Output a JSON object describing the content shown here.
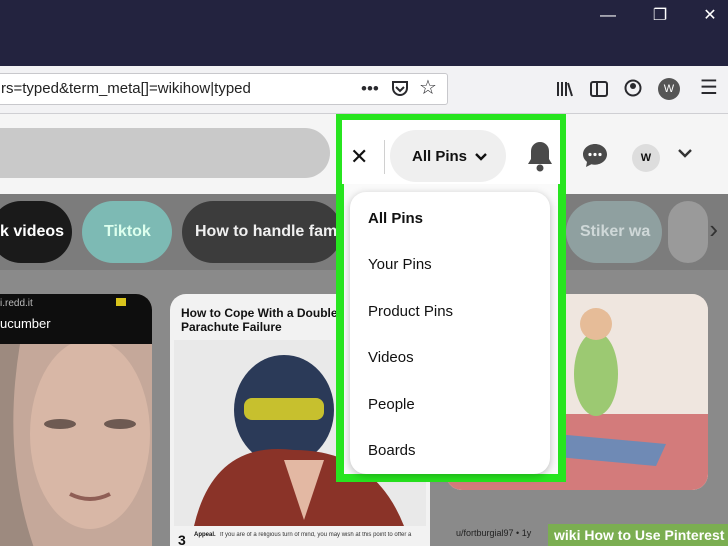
{
  "window": {
    "controls": [
      "—",
      "❐",
      "✕"
    ]
  },
  "toolbar": {
    "url": "rs=typed&term_meta[]=wikihow|typed",
    "icons": [
      "more-icon",
      "pocket-icon",
      "star-icon",
      "library-icon",
      "sidebar-icon",
      "account-icon",
      "profile-icon",
      "menu-icon"
    ],
    "profile_initial": "W"
  },
  "header": {
    "close_symbol": "✕",
    "filter_label": "All Pins",
    "user_initial": "W"
  },
  "chips": [
    {
      "label": "k videos"
    },
    {
      "label": "Tiktok"
    },
    {
      "label": "How to handle fame"
    },
    {
      "label": "Stiker wa"
    }
  ],
  "dropdown": {
    "items": [
      "All Pins",
      "Your Pins",
      "Product Pins",
      "Videos",
      "People",
      "Boards"
    ],
    "selected_index": 0
  },
  "cards": {
    "card1": {
      "source": "i.redd.it",
      "title": "ucumber"
    },
    "card2": {
      "title": "How to Cope With a Double Parachute Failure",
      "step_number": "3",
      "step_text": "Appeal.",
      "step_body": "If you are of a religious turn of mind, you may wish at this point to offer a"
    },
    "card4": {
      "footer_left": "u/fortburgial97 • 1y"
    }
  },
  "watermark": {
    "wiki": "wiki",
    "text": "How to Use Pinterest"
  },
  "colors": {
    "highlight": "#27e51f",
    "titlebar": "#23233f"
  }
}
